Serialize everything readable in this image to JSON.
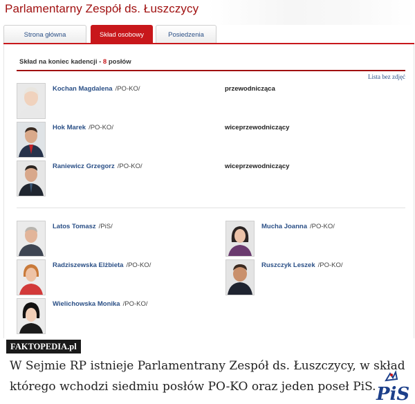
{
  "header": {
    "title": "Parlamentarny Zespół ds. Łuszczycy"
  },
  "tabs": [
    {
      "label": "Strona główna",
      "active": false
    },
    {
      "label": "Skład osobowy",
      "active": true
    },
    {
      "label": "Posiedzenia",
      "active": false
    }
  ],
  "section": {
    "heading_prefix": "Skład na koniec kadencji - ",
    "count": "8",
    "heading_suffix": " posłów",
    "photo_link": "Lista bez zdjęć"
  },
  "leaders": [
    {
      "name": "Kochan Magdalena",
      "party": "/PO-KO/",
      "role": "przewodnicząca"
    },
    {
      "name": "Hok Marek",
      "party": "/PO-KO/",
      "role": "wiceprzewodniczący"
    },
    {
      "name": "Raniewicz Grzegorz",
      "party": "/PO-KO/",
      "role": "wiceprzewodniczący"
    }
  ],
  "members": [
    {
      "name": "Latos Tomasz",
      "party": "/PiS/"
    },
    {
      "name": "Mucha Joanna",
      "party": "/PO-KO/"
    },
    {
      "name": "Radziszewska Elżbieta",
      "party": "/PO-KO/"
    },
    {
      "name": "Ruszczyk Leszek",
      "party": "/PO-KO/"
    },
    {
      "name": "Wielichowska Monika",
      "party": "/PO-KO/"
    }
  ],
  "watermark": "FAKTOPEDIA.pl",
  "caption": "W Sejmie RP istnieje Parlamentrany Zespół ds. Łuszczycy, w skład którego wchodzi siedmiu posłów PO-KO oraz jeden poseł PiS.",
  "logo_text": "PiS",
  "colors": {
    "accent_red": "#c8171b",
    "title_red": "#a01010",
    "link_blue": "#2a4f86"
  }
}
